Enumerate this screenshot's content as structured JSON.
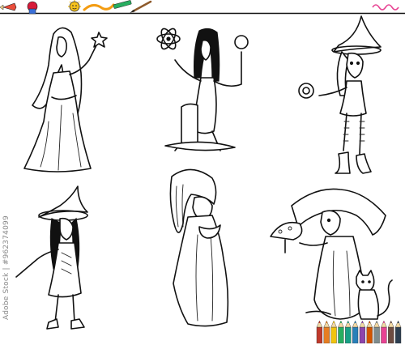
{
  "page": {
    "background": "#ffffff",
    "line_color": "#111111"
  },
  "header": {
    "icons": [
      "pencil-icon",
      "crayon-icon",
      "sun-icon",
      "crayon-icon",
      "brush-icon",
      "squiggle-icon"
    ],
    "rule_color": "#111111"
  },
  "watermark": {
    "stock_id": "Adobe Stock | #962374099"
  },
  "illustration": {
    "figures": [
      "fairy-princess-with-wand",
      "witch-sitting-on-stump-with-magic-symbols",
      "young-witch-with-pointed-hat",
      "little-witch-with-wand",
      "old-hunched-witch",
      "old-witch-with-mushroom-and-cat"
    ]
  },
  "footer": {
    "pencil_colors": [
      "#c0392b",
      "#e67e22",
      "#f1c40f",
      "#27ae60",
      "#16a085",
      "#2980b9",
      "#8e44ad",
      "#d35400",
      "#7f8c8d",
      "#e84393",
      "#6d4c41",
      "#2c3e50"
    ]
  }
}
